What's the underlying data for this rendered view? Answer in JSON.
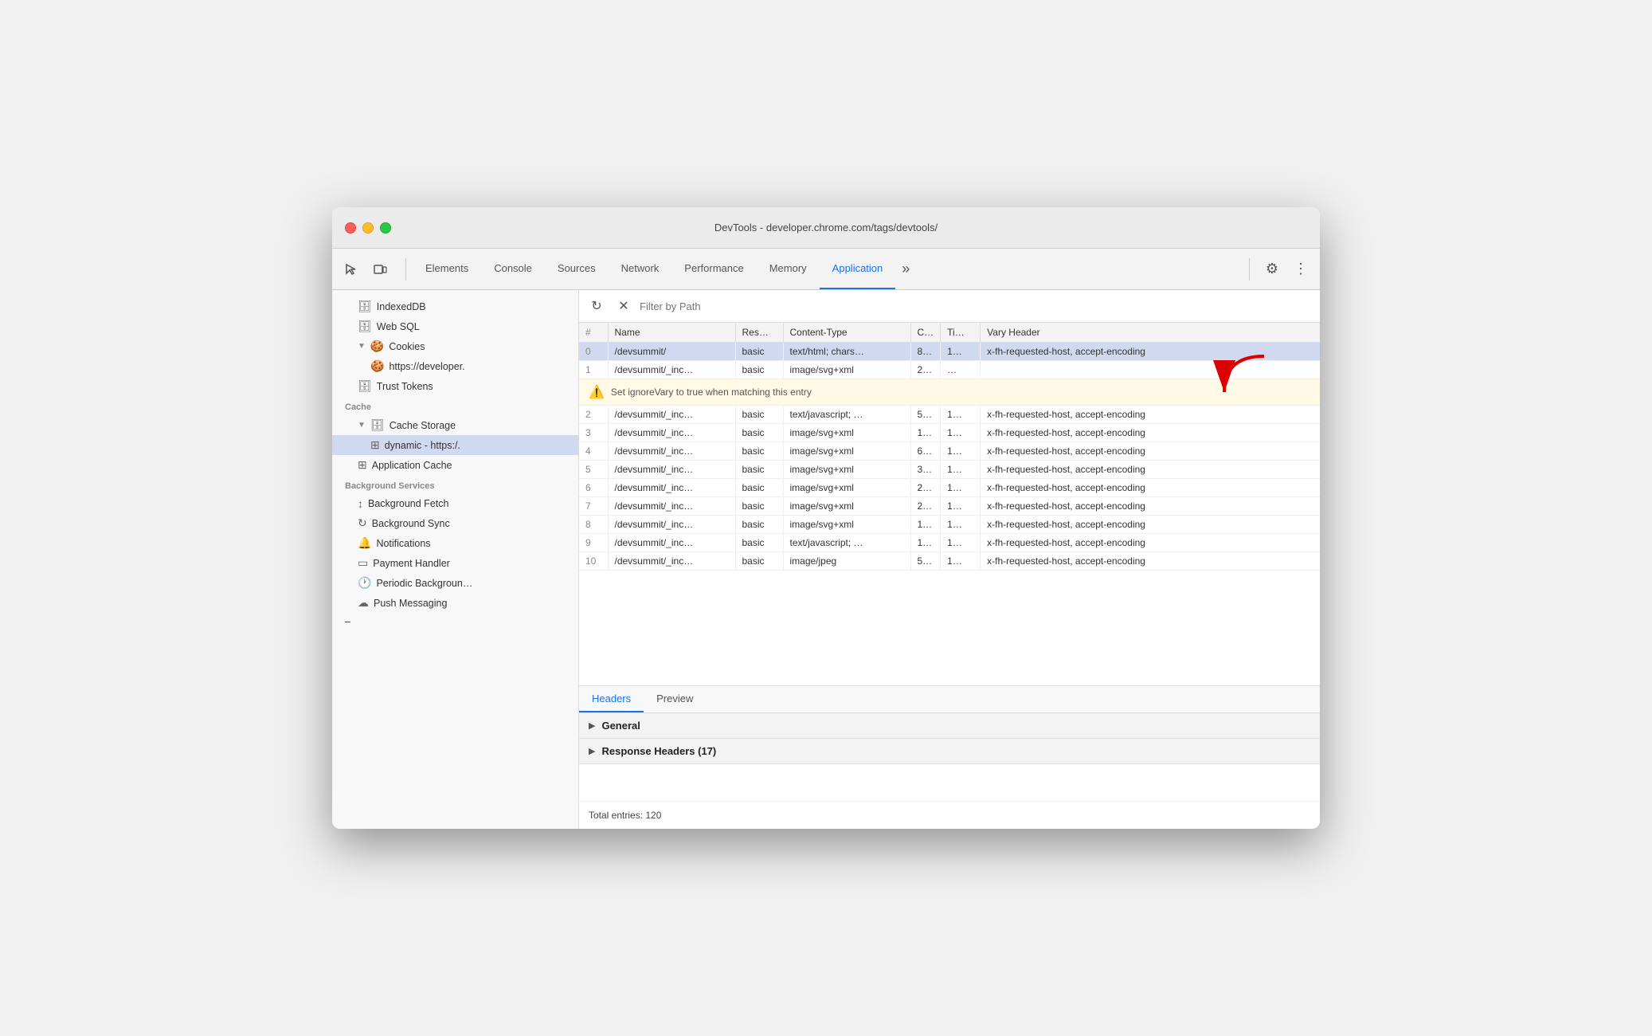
{
  "titlebar": {
    "title": "DevTools - developer.chrome.com/tags/devtools/"
  },
  "tabs": [
    {
      "id": "elements",
      "label": "Elements",
      "active": false
    },
    {
      "id": "console",
      "label": "Console",
      "active": false
    },
    {
      "id": "sources",
      "label": "Sources",
      "active": false
    },
    {
      "id": "network",
      "label": "Network",
      "active": false
    },
    {
      "id": "performance",
      "label": "Performance",
      "active": false
    },
    {
      "id": "memory",
      "label": "Memory",
      "active": false
    },
    {
      "id": "application",
      "label": "Application",
      "active": true
    }
  ],
  "sidebar": {
    "items": [
      {
        "id": "indexeddb",
        "label": "IndexedDB",
        "icon": "🗄",
        "indent": 1,
        "type": "db"
      },
      {
        "id": "websql",
        "label": "Web SQL",
        "icon": "🗄",
        "indent": 1,
        "type": "db"
      },
      {
        "id": "cookies",
        "label": "Cookies",
        "icon": "🍪",
        "indent": 1,
        "expanded": true,
        "type": "section"
      },
      {
        "id": "cookies-url",
        "label": "https://developer.",
        "icon": "🍪",
        "indent": 2,
        "type": "item"
      },
      {
        "id": "trust-tokens",
        "label": "Trust Tokens",
        "icon": "🗄",
        "indent": 1,
        "type": "db"
      },
      {
        "id": "cache-section",
        "label": "Cache",
        "indent": 0,
        "type": "header"
      },
      {
        "id": "cache-storage",
        "label": "Cache Storage",
        "icon": "🗄",
        "indent": 1,
        "expanded": true,
        "type": "section"
      },
      {
        "id": "dynamic",
        "label": "dynamic - https:/.",
        "icon": "⊞",
        "indent": 2,
        "type": "item",
        "selected": true
      },
      {
        "id": "app-cache",
        "label": "Application Cache",
        "icon": "⊞",
        "indent": 1,
        "type": "item"
      },
      {
        "id": "bg-services-section",
        "label": "Background Services",
        "indent": 0,
        "type": "header"
      },
      {
        "id": "bg-fetch",
        "label": "Background Fetch",
        "icon": "↕",
        "indent": 1,
        "type": "item"
      },
      {
        "id": "bg-sync",
        "label": "Background Sync",
        "icon": "↻",
        "indent": 1,
        "type": "item"
      },
      {
        "id": "notifications",
        "label": "Notifications",
        "icon": "🔔",
        "indent": 1,
        "type": "item"
      },
      {
        "id": "payment-handler",
        "label": "Payment Handler",
        "icon": "💳",
        "indent": 1,
        "type": "item"
      },
      {
        "id": "periodic-bg",
        "label": "Periodic Backgroun…",
        "icon": "🕐",
        "indent": 1,
        "type": "item"
      },
      {
        "id": "push-messaging",
        "label": "Push Messaging",
        "icon": "☁",
        "indent": 1,
        "type": "item"
      }
    ]
  },
  "filter": {
    "placeholder": "Filter by Path"
  },
  "table": {
    "columns": [
      "#",
      "Name",
      "Res…",
      "Content-Type",
      "C…",
      "Ti…",
      "Vary Header"
    ],
    "rows": [
      {
        "num": "0",
        "name": "/devsummit/",
        "res": "basic",
        "ct": "text/html; chars…",
        "c": "8…",
        "ti": "1…",
        "vary": "x-fh-requested-host, accept-encoding",
        "selected": true
      },
      {
        "num": "1",
        "name": "/devsummit/_inc…",
        "res": "basic",
        "ct": "image/svg+xml",
        "c": "2…",
        "ti": "…",
        "vary": "",
        "tooltip": true
      },
      {
        "num": "2",
        "name": "/devsummit/_inc…",
        "res": "basic",
        "ct": "text/javascript; …",
        "c": "5…",
        "ti": "1…",
        "vary": "x-fh-requested-host, accept-encoding"
      },
      {
        "num": "3",
        "name": "/devsummit/_inc…",
        "res": "basic",
        "ct": "image/svg+xml",
        "c": "1…",
        "ti": "1…",
        "vary": "x-fh-requested-host, accept-encoding"
      },
      {
        "num": "4",
        "name": "/devsummit/_inc…",
        "res": "basic",
        "ct": "image/svg+xml",
        "c": "6…",
        "ti": "1…",
        "vary": "x-fh-requested-host, accept-encoding"
      },
      {
        "num": "5",
        "name": "/devsummit/_inc…",
        "res": "basic",
        "ct": "image/svg+xml",
        "c": "3…",
        "ti": "1…",
        "vary": "x-fh-requested-host, accept-encoding"
      },
      {
        "num": "6",
        "name": "/devsummit/_inc…",
        "res": "basic",
        "ct": "image/svg+xml",
        "c": "2…",
        "ti": "1…",
        "vary": "x-fh-requested-host, accept-encoding"
      },
      {
        "num": "7",
        "name": "/devsummit/_inc…",
        "res": "basic",
        "ct": "image/svg+xml",
        "c": "2…",
        "ti": "1…",
        "vary": "x-fh-requested-host, accept-encoding"
      },
      {
        "num": "8",
        "name": "/devsummit/_inc…",
        "res": "basic",
        "ct": "image/svg+xml",
        "c": "1…",
        "ti": "1…",
        "vary": "x-fh-requested-host, accept-encoding"
      },
      {
        "num": "9",
        "name": "/devsummit/_inc…",
        "res": "basic",
        "ct": "text/javascript; …",
        "c": "1…",
        "ti": "1…",
        "vary": "x-fh-requested-host, accept-encoding"
      },
      {
        "num": "10",
        "name": "/devsummit/_inc…",
        "res": "basic",
        "ct": "image/jpeg",
        "c": "5…",
        "ti": "1…",
        "vary": "x-fh-requested-host, accept-encoding"
      }
    ],
    "tooltip_text": "Set ignoreVary to true when matching this entry"
  },
  "bottom_panel": {
    "tabs": [
      {
        "id": "headers",
        "label": "Headers",
        "active": true
      },
      {
        "id": "preview",
        "label": "Preview",
        "active": false
      }
    ],
    "sections": [
      {
        "id": "general",
        "label": "General",
        "expanded": false
      },
      {
        "id": "response-headers",
        "label": "Response Headers (17)",
        "expanded": false
      }
    ],
    "total_entries": "Total entries: 120"
  }
}
